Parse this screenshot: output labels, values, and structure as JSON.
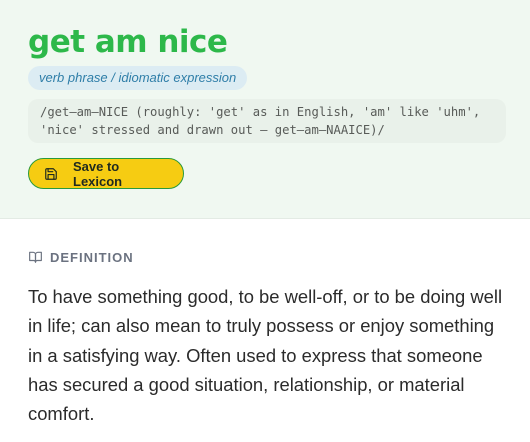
{
  "entry": {
    "word": "get am nice",
    "part_of_speech": "verb phrase / idiomatic expression",
    "pronunciation": "/get–am–NICE (roughly: 'get' as in English, 'am' like 'uhm', 'nice' stressed and drawn out – get–am–NAAICE)/",
    "save_label": "Save to Lexicon",
    "save_icon": "floppy-disk-icon"
  },
  "definition": {
    "section_icon": "open-book-icon",
    "section_label": "DEFINITION",
    "text": "To have something good, to be well-off, or to be doing well in life; can also mean to truly possess or enjoy something in a satisfying way. Often used to express that someone has secured a good situation, relationship, or material comfort."
  },
  "colors": {
    "word": "#2db84a",
    "header_bg": "#f0f8f1",
    "pos_bg": "#dcecf3",
    "pos_text": "#2f7ea8",
    "button_bg": "#f6cc12",
    "button_border": "#2a9a3a"
  }
}
